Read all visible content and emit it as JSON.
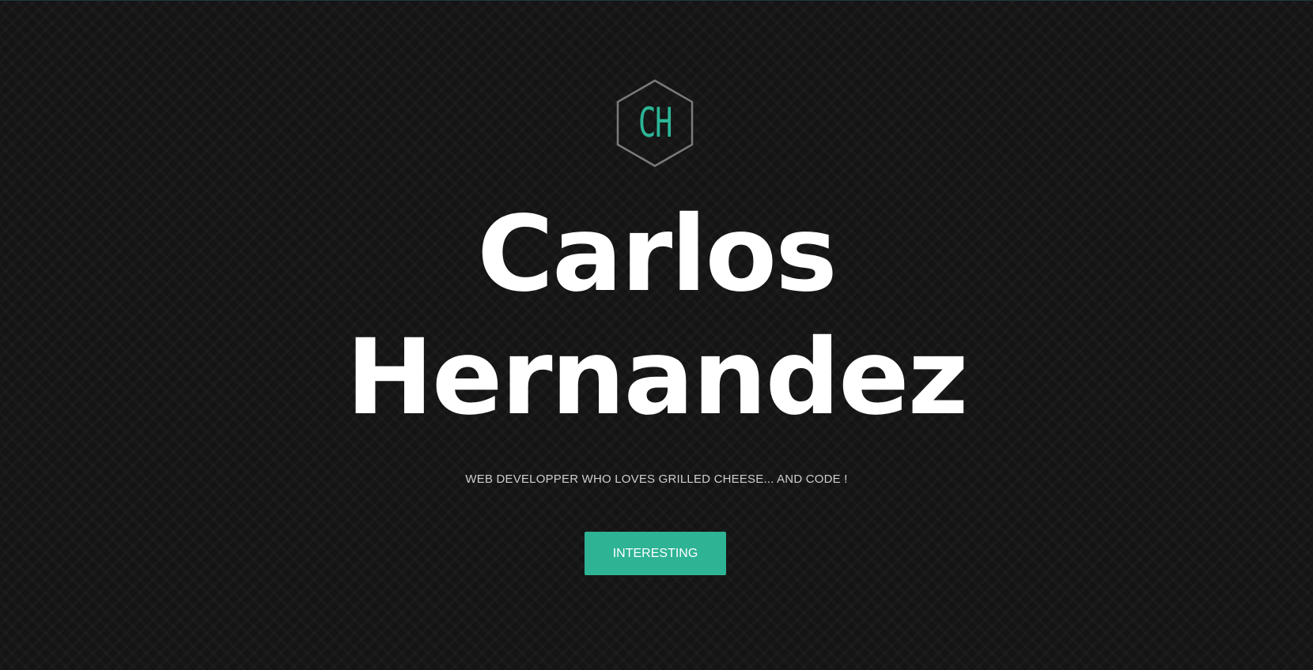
{
  "logo": {
    "initials": "CH",
    "accent_color": "#2bb596",
    "frame_color": "#7a7a7a"
  },
  "hero": {
    "first_name": "Carlos",
    "last_name": "Hernandez",
    "tagline": "WEB DEVELOPPER WHO LOVES GRILLED CHEESE... AND CODE !",
    "cta_label": "INTERESTING",
    "cta_color": "#2eb395"
  }
}
